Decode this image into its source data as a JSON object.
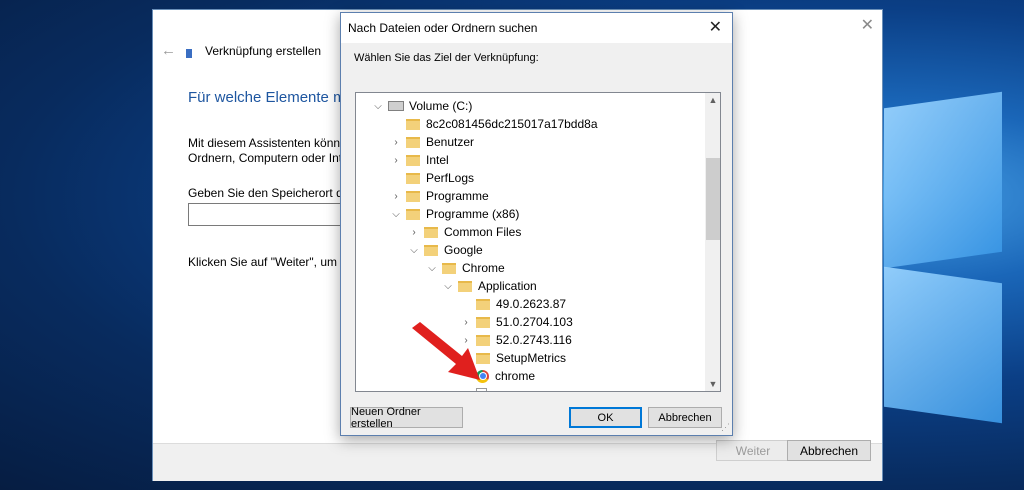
{
  "wizard": {
    "title": "Verknüpfung erstellen",
    "heading": "Für welche Elemente mö",
    "desc_line1": "Mit diesem Assistenten können",
    "desc_line2": "Ordnern, Computern oder Inter",
    "location_label": "Geben Sie den Speicherort des E",
    "location_value": "",
    "hint": "Klicken Sie auf \"Weiter\", um der",
    "next_button": "Weiter",
    "cancel_button": "Abbrechen"
  },
  "dialog": {
    "title": "Nach Dateien oder Ordnern suchen",
    "prompt": "Wählen Sie das Ziel der Verknüpfung:",
    "new_folder_button": "Neuen Ordner erstellen",
    "ok_button": "OK",
    "cancel_button": "Abbrechen",
    "tree": [
      {
        "label": "Volume (C:)",
        "icon": "drive-icon",
        "expander": "expanded"
      },
      {
        "label": "8c2c081456dc215017a17bdd8a",
        "icon": "folder-icon",
        "expander": "none"
      },
      {
        "label": "Benutzer",
        "icon": "folder-icon",
        "expander": "collapsed"
      },
      {
        "label": "Intel",
        "icon": "folder-icon",
        "expander": "collapsed"
      },
      {
        "label": "PerfLogs",
        "icon": "folder-icon",
        "expander": "none"
      },
      {
        "label": "Programme",
        "icon": "folder-icon",
        "expander": "collapsed"
      },
      {
        "label": "Programme (x86)",
        "icon": "folder-icon",
        "expander": "expanded"
      },
      {
        "label": "Common Files",
        "icon": "folder-icon",
        "expander": "collapsed"
      },
      {
        "label": "Google",
        "icon": "folder-icon",
        "expander": "expanded"
      },
      {
        "label": "Chrome",
        "icon": "folder-icon",
        "expander": "expanded"
      },
      {
        "label": "Application",
        "icon": "folder-icon",
        "expander": "expanded"
      },
      {
        "label": "49.0.2623.87",
        "icon": "folder-icon",
        "expander": "none"
      },
      {
        "label": "51.0.2704.103",
        "icon": "folder-icon",
        "expander": "collapsed"
      },
      {
        "label": "52.0.2743.116",
        "icon": "folder-icon",
        "expander": "collapsed"
      },
      {
        "label": "SetupMetrics",
        "icon": "folder-icon",
        "expander": "none"
      },
      {
        "label": "chrome",
        "icon": "chrome-icon",
        "expander": "none"
      }
    ]
  },
  "annotation": {
    "arrow_color": "#e0201e",
    "arrow_icon": "red-arrow-icon"
  },
  "colors": {
    "heading": "#1e56a0",
    "selection": "#cce8ff",
    "accent": "#0078d7"
  }
}
